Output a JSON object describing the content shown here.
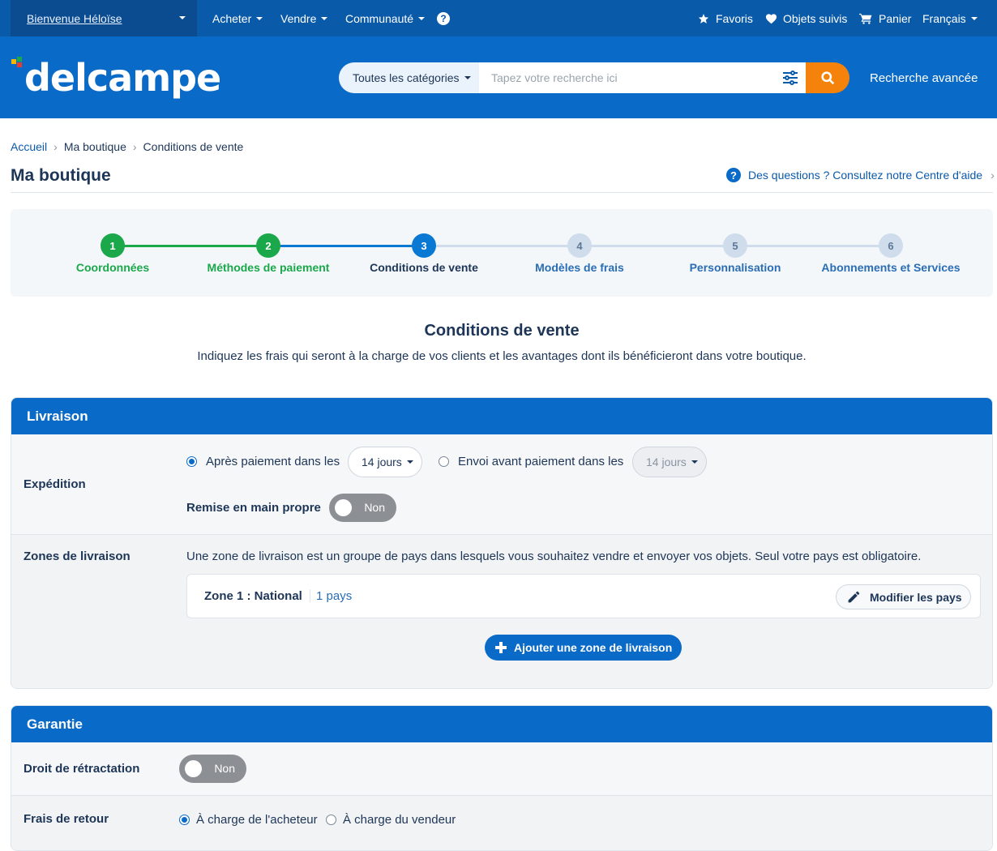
{
  "topbar": {
    "welcome": "Bienvenue Héloïse",
    "nav": [
      "Acheter",
      "Vendre",
      "Communauté"
    ],
    "help_icon": "?",
    "favoris": "Favoris",
    "objets_suivis": "Objets suivis",
    "panier": "Panier",
    "langue": "Français"
  },
  "header": {
    "logo": "delcampe",
    "category_select": "Toutes les catégories",
    "search_placeholder": "Tapez votre recherche ici",
    "advanced_search": "Recherche avancée"
  },
  "breadcrumb": [
    "Accueil",
    "Ma boutique",
    "Conditions de vente"
  ],
  "page_title": "Ma boutique",
  "help_link": "Des questions ? Consultez notre Centre d'aide",
  "steps": [
    {
      "num": "1",
      "label": "Coordonnées",
      "state": "done"
    },
    {
      "num": "2",
      "label": "Méthodes de paiement",
      "state": "done"
    },
    {
      "num": "3",
      "label": "Conditions de vente",
      "state": "current"
    },
    {
      "num": "4",
      "label": "Modèles de frais",
      "state": "todo"
    },
    {
      "num": "5",
      "label": "Personnalisation",
      "state": "todo"
    },
    {
      "num": "6",
      "label": "Abonnements et Services",
      "state": "todo"
    }
  ],
  "section": {
    "title": "Conditions de vente",
    "subtitle": "Indiquez les frais qui seront à la charge de vos clients et les avantages dont ils bénéficieront dans votre boutique."
  },
  "livraison": {
    "title": "Livraison",
    "expedition": {
      "label": "Expédition",
      "option1": "Après paiement dans les",
      "option1_value": "14 jours",
      "option2": "Envoi avant paiement dans les",
      "option2_value": "14 jours",
      "remise_label": "Remise en main propre",
      "remise_value": "Non"
    },
    "zones": {
      "label": "Zones de livraison",
      "description": "Une zone de livraison est un groupe de pays dans lesquels vous souhaitez vendre et envoyer vos objets. Seul votre pays est obligatoire.",
      "zone_name": "Zone 1 : National",
      "zone_count": "1 pays",
      "modify_button": "Modifier les pays",
      "add_button": "Ajouter une zone de livraison"
    }
  },
  "garantie": {
    "title": "Garantie",
    "retractation_label": "Droit de rétractation",
    "retractation_value": "Non",
    "frais_retour_label": "Frais de retour",
    "option1": "À charge de l'acheteur",
    "option2": "À charge du vendeur"
  },
  "colors": {
    "topbar": "#0a5aaa",
    "header": "#0a6ac7",
    "done": "#1aa84a",
    "current": "#0a79d4",
    "todo": "#cfdcec",
    "search_button": "#f5830b"
  }
}
